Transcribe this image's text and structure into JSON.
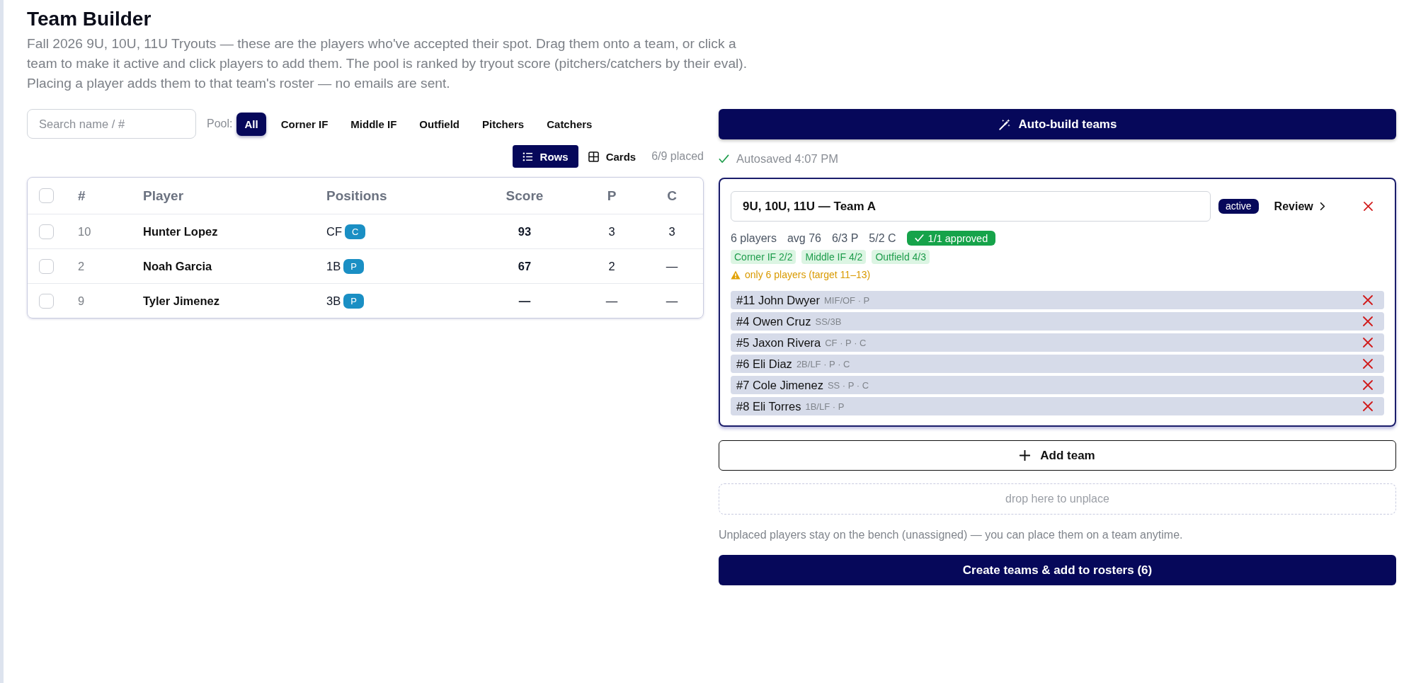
{
  "page": {
    "title": "Team Builder",
    "description": "Fall 2026 9U, 10U, 11U Tryouts — these are the players who've accepted their spot. Drag them onto a team, or click a team to make it active and click players to add them. The pool is ranked by tryout score (pitchers/catchers by their eval). Placing a player adds them to that team's roster — no emails are sent."
  },
  "pool": {
    "search": {
      "placeholder": "Search name / #"
    },
    "label": "Pool:",
    "filters": [
      {
        "label": "All",
        "selected": true
      },
      {
        "label": "Corner IF",
        "selected": false
      },
      {
        "label": "Middle IF",
        "selected": false
      },
      {
        "label": "Outfield",
        "selected": false
      },
      {
        "label": "Pitchers",
        "selected": false
      },
      {
        "label": "Catchers",
        "selected": false
      }
    ],
    "views": [
      {
        "kind": "list",
        "label": "Rows",
        "selected": true
      },
      {
        "kind": "grid",
        "label": "Cards",
        "selected": false
      }
    ],
    "placed": "6/9 placed"
  },
  "table": {
    "select_all": {
      "checked": false
    },
    "columns": [
      "#",
      "Player",
      "Positions",
      "Score",
      "P",
      "C"
    ],
    "rows": [
      {
        "checked": false,
        "number": "10",
        "player": "Hunter Lopez",
        "position": "CF",
        "badge": "C",
        "score": "93",
        "p": "3",
        "c": "3"
      },
      {
        "checked": false,
        "number": "2",
        "player": "Noah Garcia",
        "position": "1B",
        "badge": "P",
        "score": "67",
        "p": "2",
        "c": "—"
      },
      {
        "checked": false,
        "number": "9",
        "player": "Tyler Jimenez",
        "position": "3B",
        "badge": "P",
        "score": "—",
        "p": "—",
        "c": "—"
      }
    ]
  },
  "builder": {
    "auto_build": "Auto-build teams",
    "autosave": "Autosaved 4:07 PM",
    "teams": [
      {
        "name": "9U, 10U, 11U — Team A",
        "active": true,
        "active_label": "active",
        "review": "Review",
        "stats": [
          "6 players",
          "avg 76",
          "6/3 P",
          "5/2 C"
        ],
        "approval": "1/1 approved",
        "coverage": [
          "Corner IF 2/2",
          "Middle IF 4/2",
          "Outfield 4/3"
        ],
        "warning": "only 6 players (target 11–13)",
        "roster": [
          {
            "name": "#11 John Dwyer",
            "detail": "MIF/OF · P"
          },
          {
            "name": "#4 Owen Cruz",
            "detail": "SS/3B"
          },
          {
            "name": "#5 Jaxon Rivera",
            "detail": "CF · P · C"
          },
          {
            "name": "#6 Eli Diaz",
            "detail": "2B/LF · P · C"
          },
          {
            "name": "#7 Cole Jimenez",
            "detail": "SS · P · C"
          },
          {
            "name": "#8 Eli Torres",
            "detail": "1B/LF · P"
          }
        ]
      }
    ],
    "add_team": "Add team",
    "drop_zone": "drop here to unplace",
    "note": "Unplaced players stay on the bench (unassigned) — you can place them on a team anytime.",
    "submit": "Create teams & add to rosters (6)"
  }
}
